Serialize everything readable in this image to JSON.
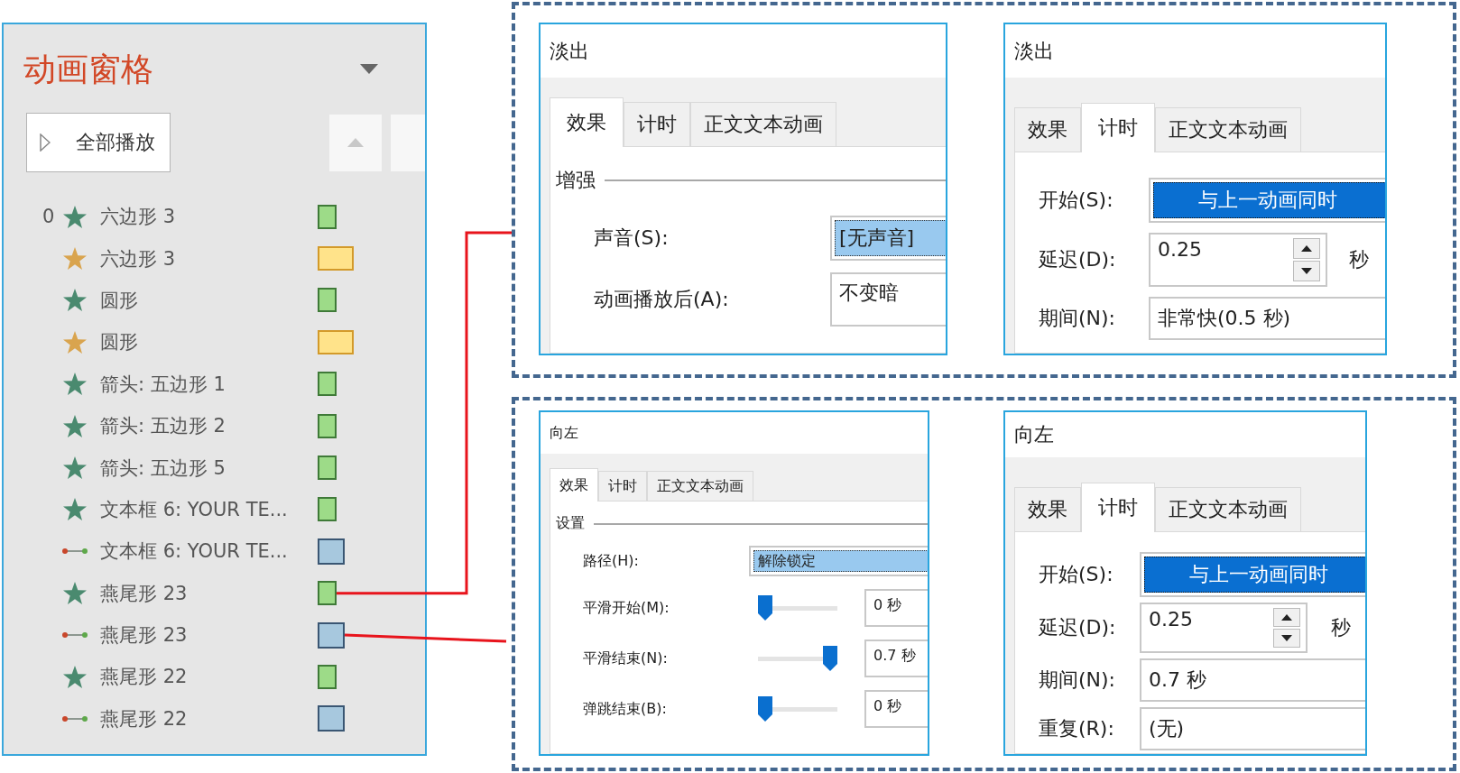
{
  "animation_pane": {
    "title": "动画窗格",
    "play_all_button": {
      "label": "全部播放"
    },
    "rows": [
      {
        "number": "0",
        "kind": "entrance",
        "label": "六边形 3"
      },
      {
        "kind": "emphasis",
        "label": "六边形 3"
      },
      {
        "kind": "entrance",
        "label": "圆形"
      },
      {
        "kind": "emphasis",
        "label": "圆形"
      },
      {
        "kind": "entrance",
        "label": "箭头: 五边形 1"
      },
      {
        "kind": "entrance",
        "label": "箭头: 五边形 2"
      },
      {
        "kind": "entrance",
        "label": "箭头: 五边形 5"
      },
      {
        "kind": "entrance",
        "label": "文本框 6: YOUR TE..."
      },
      {
        "kind": "path",
        "label": "文本框 6: YOUR TE..."
      },
      {
        "kind": "entrance",
        "label": "燕尾形 23"
      },
      {
        "kind": "path",
        "label": "燕尾形 23"
      },
      {
        "kind": "entrance",
        "label": "燕尾形 22"
      },
      {
        "kind": "path",
        "label": "燕尾形 22"
      }
    ]
  },
  "dialogs": [
    {
      "title": "淡出",
      "tabs": [
        {
          "label": "效果",
          "selected": true
        },
        {
          "label": "计时",
          "selected": false
        },
        {
          "label": "正文文本动画",
          "selected": false
        }
      ],
      "group_label": "增强",
      "fields": [
        {
          "kind": "dropdown",
          "label": "声音(S):",
          "value": "[无声音]",
          "active": false
        },
        {
          "kind": "text",
          "label": "动画播放后(A):",
          "value": "不变暗"
        }
      ]
    },
    {
      "title": "淡出",
      "tabs": [
        {
          "label": "效果",
          "selected": false
        },
        {
          "label": "计时",
          "selected": true
        },
        {
          "label": "正文文本动画",
          "selected": false
        }
      ],
      "fields": [
        {
          "kind": "dropdown",
          "label": "开始(S):",
          "value": "与上一动画同时",
          "active": true
        },
        {
          "kind": "spinner",
          "label": "延迟(D):",
          "value": "0.25",
          "unit": "秒"
        },
        {
          "kind": "text",
          "label": "期间(N):",
          "value": "非常快(0.5 秒)"
        }
      ]
    },
    {
      "title": "向左",
      "tabs": [
        {
          "label": "效果",
          "selected": true
        },
        {
          "label": "计时",
          "selected": false
        },
        {
          "label": "正文文本动画",
          "selected": false
        }
      ],
      "group_label": "设置",
      "fields": [
        {
          "kind": "dropdown",
          "label": "路径(H):",
          "value": "解除锁定",
          "active": false
        },
        {
          "kind": "slider",
          "label": "平滑开始(M):",
          "level": 0,
          "value": "0 秒"
        },
        {
          "kind": "slider",
          "label": "平滑结束(N):",
          "level": 1,
          "value": "0.7 秒"
        },
        {
          "kind": "slider",
          "label": "弹跳结束(B):",
          "level": 0,
          "value": "0 秒"
        }
      ]
    },
    {
      "title": "向左",
      "tabs": [
        {
          "label": "效果",
          "selected": false
        },
        {
          "label": "计时",
          "selected": true
        },
        {
          "label": "正文文本动画",
          "selected": false
        }
      ],
      "fields": [
        {
          "kind": "dropdown",
          "label": "开始(S):",
          "value": "与上一动画同时",
          "active": true
        },
        {
          "kind": "spinner",
          "label": "延迟(D):",
          "value": "0.25",
          "unit": "秒"
        },
        {
          "kind": "text",
          "label": "期间(N):",
          "value": "0.7 秒"
        },
        {
          "kind": "text",
          "label": "重复(R):",
          "value": "(无)"
        }
      ]
    }
  ]
}
